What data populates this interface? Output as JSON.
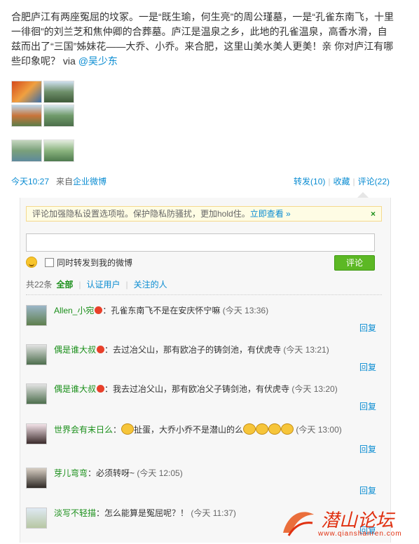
{
  "post": {
    "text": "合肥庐江有两座冤屈的坟冢。一是“既生瑜，何生亮”的周公瑾墓，一是“孔雀东南飞，十里一徘徊”的刘兰芝和焦仲卿的合葬墓。庐江是温泉之乡，此地的孔雀温泉，高香水滑，自兹而出了“三国”姊妹花——大乔、小乔。来合肥，这里山美水美人更美！亲 你对庐江有哪些印象呢？ via ",
    "via_user": "@吴少东",
    "time": "今天10:27",
    "source_prefix": "来自",
    "source": "企业微博",
    "actions": [
      "转发(10)",
      "收藏",
      "评论(22)"
    ]
  },
  "colors": {
    "accent": "#0a8cd2",
    "username": "#1a8f1a",
    "button": "#5cb824",
    "watermark": "#e03010"
  },
  "comment_box": {
    "notice": "评论加强隐私设置选项啦。保护隐私防骚扰，更加hold住。",
    "notice_link": "立即查看 »",
    "notice_close": "×",
    "input_value": "",
    "smiley_icon": "smiley-icon",
    "checkbox_label": "同时转发到我的微博",
    "submit_label": "评论",
    "filter": {
      "count": "共22条",
      "options": [
        "全部",
        "认证用户",
        "关注的人"
      ]
    }
  },
  "comments": [
    {
      "user": "Allen_小宛",
      "text": "：孔雀东南飞不是在安庆怀宁嘛",
      "time": "(今天 13:36)",
      "reply": "回复"
    },
    {
      "user": "偶是谁大叔",
      "text": "：去过冶父山，那有欧冶子的铸剑池，有伏虎寺",
      "time": "(今天 13:21)",
      "reply": "回复"
    },
    {
      "user": "偶是谁大叔",
      "text": "：我去过冶父山，那有欧冶父子铸剑池，有伏虎寺",
      "time": "(今天 13:20)",
      "reply": "回复"
    },
    {
      "user": "世界会有末日么",
      "text": "：",
      "text2": "扯蛋，大乔小乔不是潜山的么",
      "time": "(今天 13:00)",
      "reply": "回复"
    },
    {
      "user": "芽儿弯弯",
      "text": "：必须转呀~",
      "time": "(今天 12:05)",
      "reply": "回复"
    },
    {
      "user": "淡写不轻描",
      "text": "：怎么能算是冤屈呢？！",
      "time": "(今天 11:37)",
      "reply": "回复"
    }
  ],
  "watermark": {
    "text": "潜山论坛",
    "url": "www.qianshanren.com"
  }
}
